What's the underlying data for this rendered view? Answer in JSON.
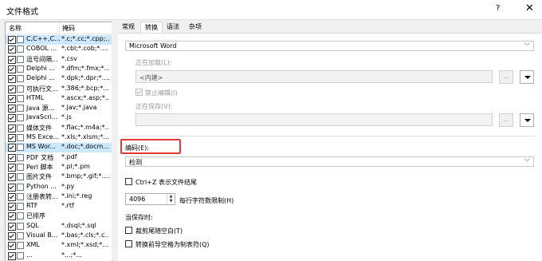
{
  "window": {
    "title": "文件格式",
    "help": "?",
    "close": "✕"
  },
  "list": {
    "headers": {
      "name": "名称",
      "ext": "掩码"
    },
    "items": [
      {
        "name": "C,C++,C...",
        "ext": "*.c;*.cc;*.cpp;...",
        "selected": true
      },
      {
        "name": "COBOL ...",
        "ext": "*.cbl;*.cob;*....",
        "selected": false
      },
      {
        "name": "逗号间隔...",
        "ext": "*.csv",
        "selected": false
      },
      {
        "name": "Delphi ...",
        "ext": "*.dfm;*.fmx;*....",
        "selected": false
      },
      {
        "name": "Delphi ...",
        "ext": "*.dpk;*.dpr;*....",
        "selected": false
      },
      {
        "name": "可执行文...",
        "ext": "*.386;*.bcp;*...",
        "selected": false
      },
      {
        "name": "HTML",
        "ext": "*.ascx;*.asp;*....",
        "selected": false
      },
      {
        "name": "Java 源...",
        "ext": "*.jav;*.java",
        "selected": false
      },
      {
        "name": "JavaScri...",
        "ext": "*.js",
        "selected": false
      },
      {
        "name": "媒体文件",
        "ext": "*.flac;*.m4a;*....",
        "selected": false
      },
      {
        "name": "MS Exce...",
        "ext": "*.xls;*.xlsm;*....",
        "selected": false
      },
      {
        "name": "MS Wor...",
        "ext": "*.doc;*.docm...",
        "selected": true
      },
      {
        "name": "PDF 文档",
        "ext": "*.pdf",
        "selected": false
      },
      {
        "name": "Perl 脚本",
        "ext": "*.pl;*.pm",
        "selected": false
      },
      {
        "name": "图片文件",
        "ext": "*.bmp;*.gif;*....",
        "selected": false
      },
      {
        "name": "Python ...",
        "ext": "*.py",
        "selected": false
      },
      {
        "name": "注册表转...",
        "ext": "*.ini;*.reg",
        "selected": false
      },
      {
        "name": "RTF",
        "ext": "*.rtf",
        "selected": false
      },
      {
        "name": "已排序",
        "ext": "",
        "selected": false
      },
      {
        "name": "SQL",
        "ext": "*.dsql;*.sql",
        "selected": false
      },
      {
        "name": "Visual B...",
        "ext": "*.bas;*.cls;*.c...",
        "selected": false
      },
      {
        "name": "XML",
        "ext": "*.xml;*.xsd;*....",
        "selected": false
      },
      {
        "name": "...",
        "ext": "*...;*...",
        "selected": false
      }
    ]
  },
  "tabs": [
    "常规",
    "转换",
    "语法",
    "杂项"
  ],
  "active_tab": 1,
  "convert": {
    "converter": "Microsoft Word",
    "loading_label": "正在加载(L):",
    "loading_value": "<内建>",
    "disable_edit_label": "禁止编辑(I)",
    "saving_label": "正在保存(V):",
    "browse_btn": "...",
    "encoding_label": "编码(E):",
    "encoding_value": "检测",
    "ctrl_z_label": "Ctrl+Z 表示文件结尾",
    "chars_per_line_value": "4096",
    "chars_per_line_label": "每行字符数限制(H)",
    "on_save_label": "当保存时:",
    "trim_trailing_label": "裁剪尾随空白(T)",
    "convert_spaces_label": "转换前导空格为制表符(Q)"
  },
  "colors": {
    "selection": "#cce8ff",
    "highlight": "#e53935"
  }
}
